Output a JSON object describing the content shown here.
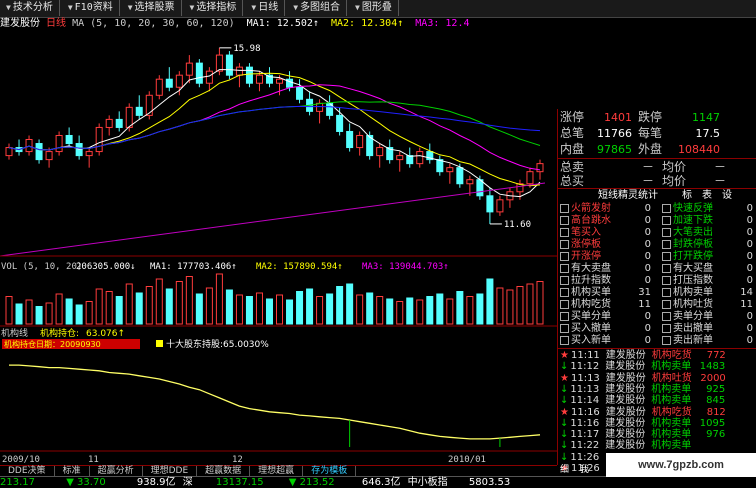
{
  "colors": {
    "up": "#ff3c3c",
    "down": "#54ffff",
    "white": "#ffffff",
    "yellow": "#ffff00",
    "magenta": "#ff00ff",
    "green": "#00d000",
    "blue": "#2020ff",
    "gray": "#999999"
  },
  "toolbar": [
    {
      "label": "技术分析",
      "icon": "chevron-down-icon"
    },
    {
      "label": "F10资料",
      "icon": "chevron-down-icon"
    },
    {
      "label": "选择股票",
      "icon": "chevron-down-icon"
    },
    {
      "label": "选择指标",
      "icon": "chevron-down-icon"
    },
    {
      "label": "日线",
      "icon": "chevron-down-icon"
    },
    {
      "label": "多图组合",
      "icon": "chevron-down-icon"
    },
    {
      "label": "图形叠",
      "icon": "chevron-down-icon"
    }
  ],
  "header": {
    "stock": "建发股份",
    "period": "日线",
    "ma_def": "MA (5, 10, 20, 30, 60, 120)",
    "ma1_label": "MA1:",
    "ma1_value": "12.502↑",
    "ma2_label": "MA2:",
    "ma2_value": "12.304↑",
    "ma3_label": "MA3:",
    "ma3_value": "12.4"
  },
  "price_labels": {
    "high": "15.98",
    "low": "11.60"
  },
  "vol": {
    "def": "VOL (5, 10, 20)",
    "value": "206305.000↓",
    "ma1": "MA1: 177703.406↑",
    "ma2": "MA2: 157890.594↑",
    "ma3": "MA3: 139044.703↑"
  },
  "inst": {
    "title": "机构线",
    "hold_label": "机构持仓:",
    "hold_value": "63.076↑",
    "badge": "机构持仓日期：20090930",
    "top10": "十大股东持股:65.0030%"
  },
  "dates": {
    "d1": "2009/10",
    "d2": "11",
    "d3": "12",
    "d4": "2010/01"
  },
  "quote": [
    {
      "l1": "涨停",
      "v1": "1401",
      "c1": "#ff3c3c",
      "l2": "跌停",
      "v2": "1147",
      "c2": "#00d000"
    },
    {
      "l1": "总笔",
      "v1": "11766",
      "c1": "#ffffff",
      "l2": "每笔",
      "v2": "17.5",
      "c2": "#ffffff"
    },
    {
      "l1": "内盘",
      "v1": "97865",
      "c1": "#00d000",
      "l2": "外盘",
      "v2": "108440",
      "c2": "#ff3c3c"
    }
  ],
  "totals": [
    {
      "label": "总卖",
      "value": "－",
      "label2": "均价",
      "value2": "－"
    },
    {
      "label": "总买",
      "value": "－",
      "label2": "均价",
      "value2": "－"
    }
  ],
  "elf": {
    "title": "短线精灵统计",
    "sub1": "标",
    "sub2": "表",
    "sub3": "设"
  },
  "elf_left": [
    {
      "label": "火箭发射",
      "value": "0"
    },
    {
      "label": "高台跳水",
      "value": "0"
    },
    {
      "label": "笔买入",
      "value": "0"
    },
    {
      "label": "涨停板",
      "value": "0"
    },
    {
      "label": "开涨停",
      "value": "0"
    },
    {
      "label": "有大卖盘",
      "value": "0"
    },
    {
      "label": "拉升指数",
      "value": "0"
    },
    {
      "label": "机构买单",
      "value": "31"
    },
    {
      "label": "机构吃货",
      "value": "11"
    },
    {
      "label": "买单分单",
      "value": "0"
    },
    {
      "label": "买入撤单",
      "value": "0"
    },
    {
      "label": "买入新单",
      "value": "0"
    }
  ],
  "elf_right": [
    {
      "label": "快速反弹",
      "value": "0"
    },
    {
      "label": "加速下跌",
      "value": "0"
    },
    {
      "label": "大笔卖出",
      "value": "0"
    },
    {
      "label": "封跌停板",
      "value": "0"
    },
    {
      "label": "打开跌停",
      "value": "0"
    },
    {
      "label": "有大买盘",
      "value": "0"
    },
    {
      "label": "打压指数",
      "value": "0"
    },
    {
      "label": "机构卖单",
      "value": "14"
    },
    {
      "label": "机构吐货",
      "value": "11"
    },
    {
      "label": "卖单分单",
      "value": "0"
    },
    {
      "label": "卖出撤单",
      "value": "0"
    },
    {
      "label": "卖出新单",
      "value": "0"
    }
  ],
  "ticks": [
    {
      "mk": "★",
      "time": "11:11",
      "name": "建发股份",
      "type": "机构吃货",
      "val": "772",
      "c": "#ff3c3c"
    },
    {
      "mk": "↓",
      "time": "11:12",
      "name": "建发股份",
      "type": "机构卖单",
      "val": "1483",
      "c": "#00d000"
    },
    {
      "mk": "★",
      "time": "11:13",
      "name": "建发股份",
      "type": "机构吐货",
      "val": "2000",
      "c": "#ff3c3c"
    },
    {
      "mk": "↓",
      "time": "11:13",
      "name": "建发股份",
      "type": "机构卖单",
      "val": "925",
      "c": "#00d000"
    },
    {
      "mk": "↓",
      "time": "11:14",
      "name": "建发股份",
      "type": "机构卖单",
      "val": "845",
      "c": "#00d000"
    },
    {
      "mk": "★",
      "time": "11:16",
      "name": "建发股份",
      "type": "机构吃货",
      "val": "812",
      "c": "#ff3c3c"
    },
    {
      "mk": "↓",
      "time": "11:16",
      "name": "建发股份",
      "type": "机构卖单",
      "val": "1095",
      "c": "#00d000"
    },
    {
      "mk": "↓",
      "time": "11:17",
      "name": "建发股份",
      "type": "机构卖单",
      "val": "976",
      "c": "#00d000"
    },
    {
      "mk": "↓",
      "time": "11:22",
      "name": "建发股份",
      "type": "机构卖单",
      "val": "",
      "c": "#00d000"
    },
    {
      "mk": "↓",
      "time": "11:26",
      "name": "",
      "type": "",
      "val": "",
      "c": "#00d000"
    },
    {
      "mk": "★",
      "time": "11:26",
      "name": "",
      "type": "",
      "val": "",
      "c": "#ff3c3c"
    }
  ],
  "tabs": [
    {
      "label": "DDE决策"
    },
    {
      "label": "标准"
    },
    {
      "label": "超赢分析"
    },
    {
      "label": "理想DDE"
    },
    {
      "label": "超赢数据"
    },
    {
      "label": "理想超赢"
    },
    {
      "label": "存为模板"
    }
  ],
  "rtabs": {
    "a": "细",
    "b": "我"
  },
  "status": {
    "s1": "213.17",
    "s2": "▼ 33.70",
    "s3": "938.9亿",
    "s4": "深",
    "s5": "13137.15",
    "s6": "▼ 213.52",
    "s7": "646.3亿",
    "s8": "中小板指",
    "s9": "5803.53"
  },
  "watermark": "www.7gpzb.com",
  "chart_data": {
    "type": "candlestick",
    "series": [
      {
        "name": "MA1",
        "value": "12.502"
      },
      {
        "name": "MA2",
        "value": "12.304"
      },
      {
        "name": "MA3",
        "value": "12.4"
      }
    ],
    "price_high": 15.98,
    "price_low": 11.6,
    "candles": [
      [
        13.3,
        13.6,
        13.2,
        13.5
      ],
      [
        13.5,
        13.7,
        13.3,
        13.4
      ],
      [
        13.4,
        13.8,
        13.3,
        13.7
      ],
      [
        13.6,
        13.7,
        13.1,
        13.2
      ],
      [
        13.2,
        13.5,
        13.0,
        13.4
      ],
      [
        13.4,
        13.9,
        13.3,
        13.8
      ],
      [
        13.8,
        14.0,
        13.5,
        13.6
      ],
      [
        13.6,
        13.8,
        13.2,
        13.3
      ],
      [
        13.3,
        13.5,
        13.0,
        13.4
      ],
      [
        13.4,
        14.1,
        13.3,
        14.0
      ],
      [
        14.0,
        14.3,
        13.8,
        14.2
      ],
      [
        14.2,
        14.4,
        13.9,
        14.0
      ],
      [
        14.0,
        14.6,
        13.9,
        14.5
      ],
      [
        14.5,
        14.8,
        14.2,
        14.3
      ],
      [
        14.3,
        14.9,
        14.2,
        14.8
      ],
      [
        14.8,
        15.3,
        14.7,
        15.2
      ],
      [
        15.2,
        15.5,
        14.9,
        15.0
      ],
      [
        15.0,
        15.4,
        14.8,
        15.3
      ],
      [
        15.3,
        15.8,
        15.1,
        15.6
      ],
      [
        15.6,
        15.7,
        15.0,
        15.1
      ],
      [
        15.1,
        15.5,
        14.9,
        15.4
      ],
      [
        15.4,
        15.98,
        15.3,
        15.8
      ],
      [
        15.8,
        15.9,
        15.2,
        15.3
      ],
      [
        15.3,
        15.6,
        15.0,
        15.5
      ],
      [
        15.5,
        15.6,
        15.0,
        15.1
      ],
      [
        15.1,
        15.4,
        14.9,
        15.3
      ],
      [
        15.3,
        15.5,
        15.0,
        15.1
      ],
      [
        15.1,
        15.3,
        14.8,
        15.2
      ],
      [
        15.2,
        15.4,
        14.9,
        15.0
      ],
      [
        15.0,
        15.2,
        14.6,
        14.7
      ],
      [
        14.7,
        14.9,
        14.3,
        14.4
      ],
      [
        14.4,
        14.7,
        14.1,
        14.6
      ],
      [
        14.6,
        14.8,
        14.2,
        14.3
      ],
      [
        14.3,
        14.5,
        13.8,
        13.9
      ],
      [
        13.9,
        14.1,
        13.4,
        13.5
      ],
      [
        13.5,
        13.9,
        13.3,
        13.8
      ],
      [
        13.8,
        13.9,
        13.2,
        13.3
      ],
      [
        13.3,
        13.6,
        13.0,
        13.5
      ],
      [
        13.5,
        13.7,
        13.1,
        13.2
      ],
      [
        13.2,
        13.4,
        12.9,
        13.3
      ],
      [
        13.3,
        13.5,
        13.0,
        13.1
      ],
      [
        13.1,
        13.5,
        13.0,
        13.4
      ],
      [
        13.4,
        13.6,
        13.1,
        13.2
      ],
      [
        13.2,
        13.3,
        12.8,
        12.9
      ],
      [
        12.9,
        13.1,
        12.6,
        13.0
      ],
      [
        13.0,
        13.1,
        12.5,
        12.6
      ],
      [
        12.6,
        12.8,
        12.3,
        12.7
      ],
      [
        12.7,
        12.8,
        12.2,
        12.3
      ],
      [
        12.3,
        12.5,
        11.6,
        11.9
      ],
      [
        11.9,
        12.3,
        11.8,
        12.2
      ],
      [
        12.2,
        12.5,
        12.0,
        12.4
      ],
      [
        12.4,
        12.7,
        12.2,
        12.6
      ],
      [
        12.6,
        13.0,
        12.5,
        12.9
      ],
      [
        12.9,
        13.2,
        12.7,
        13.1
      ]
    ],
    "volume": [
      55,
      40,
      48,
      35,
      42,
      60,
      50,
      38,
      45,
      70,
      65,
      55,
      80,
      62,
      75,
      90,
      70,
      85,
      95,
      60,
      72,
      100,
      68,
      58,
      55,
      62,
      50,
      58,
      48,
      65,
      70,
      55,
      60,
      75,
      80,
      58,
      62,
      55,
      50,
      45,
      52,
      48,
      55,
      60,
      50,
      65,
      55,
      60,
      90,
      72,
      68,
      75,
      80,
      85
    ],
    "inst_line": [
      0.95,
      0.95,
      0.94,
      0.93,
      0.92,
      0.92,
      0.91,
      0.9,
      0.89,
      0.88,
      0.86,
      0.85,
      0.84,
      0.82,
      0.8,
      0.78,
      0.75,
      0.72,
      0.68,
      0.65,
      0.6,
      0.55,
      0.5,
      0.45,
      0.42,
      0.4,
      0.38,
      0.37,
      0.36,
      0.34,
      0.33,
      0.32,
      0.31,
      0.3,
      0.28,
      0.26,
      0.24,
      0.22,
      0.2,
      0.18,
      0.15,
      0.12,
      0.1,
      0.08,
      0.07,
      0.06,
      0.05,
      0.05,
      0.05,
      0.06,
      0.07,
      0.08,
      0.09,
      0.1
    ]
  }
}
